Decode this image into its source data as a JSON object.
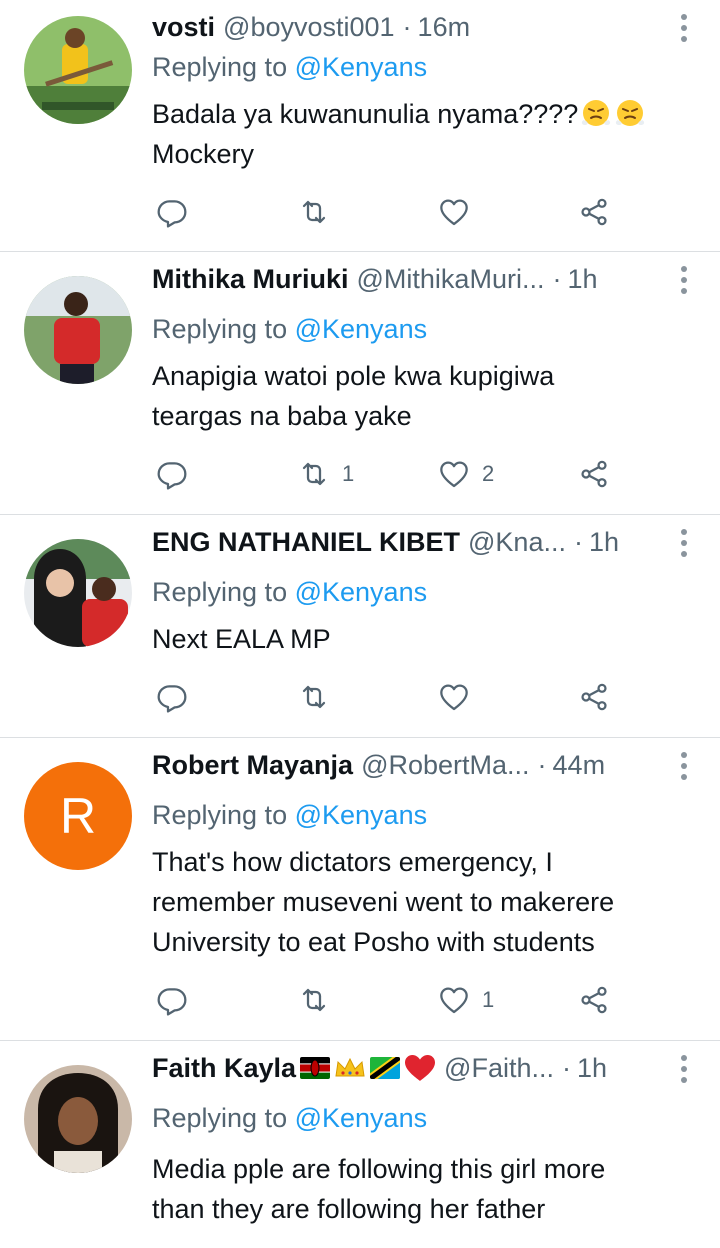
{
  "reply_prefix": "Replying to",
  "reply_target": "@Kenyans",
  "tweets": [
    {
      "name": "vosti",
      "handle": "@boyvosti001",
      "time": "16m",
      "lines": [
        "Badala ya kuwanunulia nyama????",
        "Mockery"
      ],
      "emoji_after_line1": [
        "steam-from-nose-emoji",
        "steam-from-nose-emoji"
      ],
      "replies": "",
      "retweets": "",
      "likes": "",
      "avatar": "photo-boy-field"
    },
    {
      "name": "Mithika Muriuki",
      "handle": "@MithikaMuri...",
      "time": "1h",
      "lines": [
        "Anapigia watoi pole kwa kupigiwa",
        "teargas na baba yake"
      ],
      "replies": "",
      "retweets": "1",
      "likes": "2",
      "avatar": "photo-man-red-shirt"
    },
    {
      "name": "ENG NATHANIEL KIBET",
      "handle": "@Kna...",
      "time": "1h",
      "lines": [
        "Next EALA MP"
      ],
      "replies": "",
      "retweets": "",
      "likes": "",
      "avatar": "photo-couple"
    },
    {
      "name": "Robert Mayanja",
      "handle": "@RobertMa...",
      "time": "44m",
      "lines": [
        "That's how dictators emergency, I",
        "remember museveni went to makerere",
        "University to eat Posho with students"
      ],
      "replies": "",
      "retweets": "",
      "likes": "1",
      "avatar_letter": "R",
      "avatar_color": "#f4700a"
    },
    {
      "name": "Faith Kayla",
      "handle": "@Faith...",
      "time": "1h",
      "name_emoji": [
        "kenya-flag-emoji",
        "crown-emoji",
        "tanzania-flag-emoji",
        "red-heart-emoji"
      ],
      "lines": [
        "Media pple are following this girl more",
        "than they are following her father"
      ],
      "replies": "",
      "retweets": "",
      "likes": "",
      "avatar": "photo-woman"
    }
  ],
  "colors": {
    "link": "#1d9bf0",
    "secondary_text": "#536471",
    "divider": "#dcdfe2",
    "icon": "#536471"
  }
}
